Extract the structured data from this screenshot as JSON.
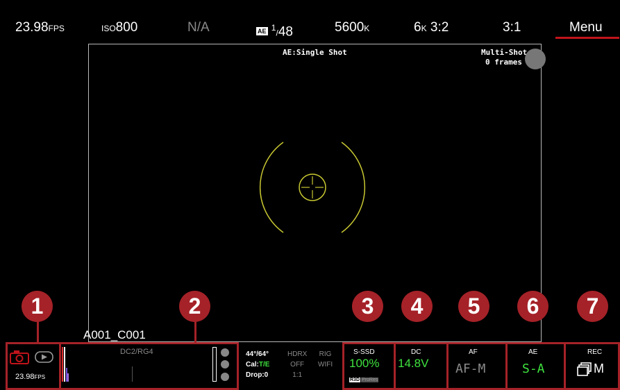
{
  "top_bar": {
    "fps_value": "23.98",
    "fps_unit": "FPS",
    "iso_label": "ISO",
    "iso_value": "800",
    "na_text": "N/A",
    "ae_badge": "AE",
    "shutter_num": "1",
    "shutter_den": "48",
    "white_balance_value": "5600",
    "white_balance_unit": "K",
    "resolution_value": "6",
    "resolution_unit": "K",
    "aspect": "3:2",
    "compression": "3:1",
    "menu_label": "Menu"
  },
  "viewfinder": {
    "ae_mode_text": "AE:Single Shot",
    "multishot_label": "Multi-Shot",
    "frames_text": "0 frames",
    "clip_name": "A001_C001"
  },
  "markers": [
    "1",
    "2",
    "3",
    "4",
    "5",
    "6",
    "7"
  ],
  "bottom": {
    "mode_fps": "23.98",
    "mode_fps_unit": "FPS",
    "histogram_label": "DC2/RG4",
    "angle_text": "44°/64°",
    "cal_label": "Cal:",
    "cal_value": "T/E",
    "drop_text": "Drop:0",
    "hdrx_label": "HDRX",
    "hdrx_value": "OFF",
    "ratio_value": "1:1",
    "rig_label": "RIG",
    "wifi_label": "WIFI",
    "media_label": "S-SSD",
    "media_value": "100%",
    "format_r3d": "R3D",
    "format_prores": "ProRes",
    "power_label": "DC",
    "power_value": "14.8V",
    "af_label": "AF",
    "af_value": "AF-M",
    "ae_label": "AE",
    "ae_value": "S-A",
    "rec_label": "REC",
    "rec_value": "M"
  },
  "colors": {
    "accent_red": "#a52228",
    "status_green": "#3ee23e",
    "reticle_yellow": "#c8c832"
  }
}
